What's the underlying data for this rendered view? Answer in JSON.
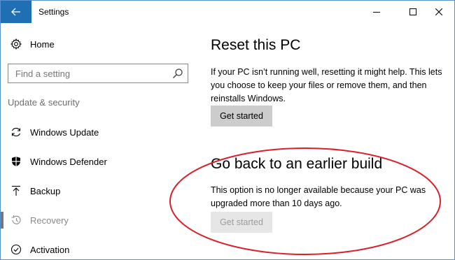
{
  "window": {
    "title": "Settings",
    "back_icon": "back-arrow-icon",
    "minimize_icon": "minimize-icon",
    "maximize_icon": "maximize-icon",
    "close_icon": "close-icon"
  },
  "sidebar": {
    "home": {
      "label": "Home",
      "icon": "gear-icon"
    },
    "search": {
      "placeholder": "Find a setting",
      "icon": "search-icon"
    },
    "section_title": "Update & security",
    "items": [
      {
        "label": "Windows Update",
        "icon": "sync-icon",
        "selected": false,
        "disabled": false
      },
      {
        "label": "Windows Defender",
        "icon": "shield-icon",
        "selected": false,
        "disabled": false
      },
      {
        "label": "Backup",
        "icon": "upload-arrow-icon",
        "selected": false,
        "disabled": false
      },
      {
        "label": "Recovery",
        "icon": "history-icon",
        "selected": true,
        "disabled": true
      },
      {
        "label": "Activation",
        "icon": "check-circle-icon",
        "selected": false,
        "disabled": false
      }
    ]
  },
  "main": {
    "reset": {
      "heading": "Reset this PC",
      "text": "If your PC isn’t running well, resetting it might help. This lets you choose to keep your files or remove them, and then reinstalls Windows.",
      "button": "Get started"
    },
    "go_back": {
      "heading": "Go back to an earlier build",
      "text": "This option is no longer available because your PC was upgraded more than 10 days ago.",
      "button": "Get started",
      "button_disabled": true
    }
  },
  "colors": {
    "accent": "#1f6fb5",
    "highlight_ellipse": "#d9202a",
    "button_bg": "#cccccc",
    "disabled_text": "#8a8a8a"
  }
}
